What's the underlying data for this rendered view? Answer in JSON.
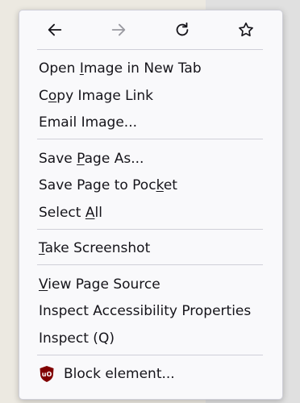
{
  "nav": {
    "back": "back-arrow",
    "forward": "forward-arrow",
    "reload": "reload",
    "bookmark": "star"
  },
  "menu": {
    "open_image_pre": "Open ",
    "open_image_key": "I",
    "open_image_post": "mage in New Tab",
    "copy_link_pre": "C",
    "copy_link_key": "o",
    "copy_link_post": "py Image Link",
    "email_image": "Email Image...",
    "save_page_pre": "Save ",
    "save_page_key": "P",
    "save_page_post": "age As...",
    "pocket_pre": "Save Page to Poc",
    "pocket_key": "k",
    "pocket_post": "et",
    "select_all_pre": "Select ",
    "select_all_key": "A",
    "select_all_post": "ll",
    "screenshot_key": "T",
    "screenshot_post": "ake Screenshot",
    "view_source_key": "V",
    "view_source_post": "iew Page Source",
    "inspect_a11y": "Inspect Accessibility Properties",
    "inspect": "Inspect (Q)",
    "block_element": "Block element...",
    "ubo_icon_text": "uO"
  },
  "colors": {
    "menu_bg": "#f9f9fb",
    "text": "#15141a",
    "disabled_icon": "#9a9aa1",
    "ubo_red": "#800000"
  }
}
